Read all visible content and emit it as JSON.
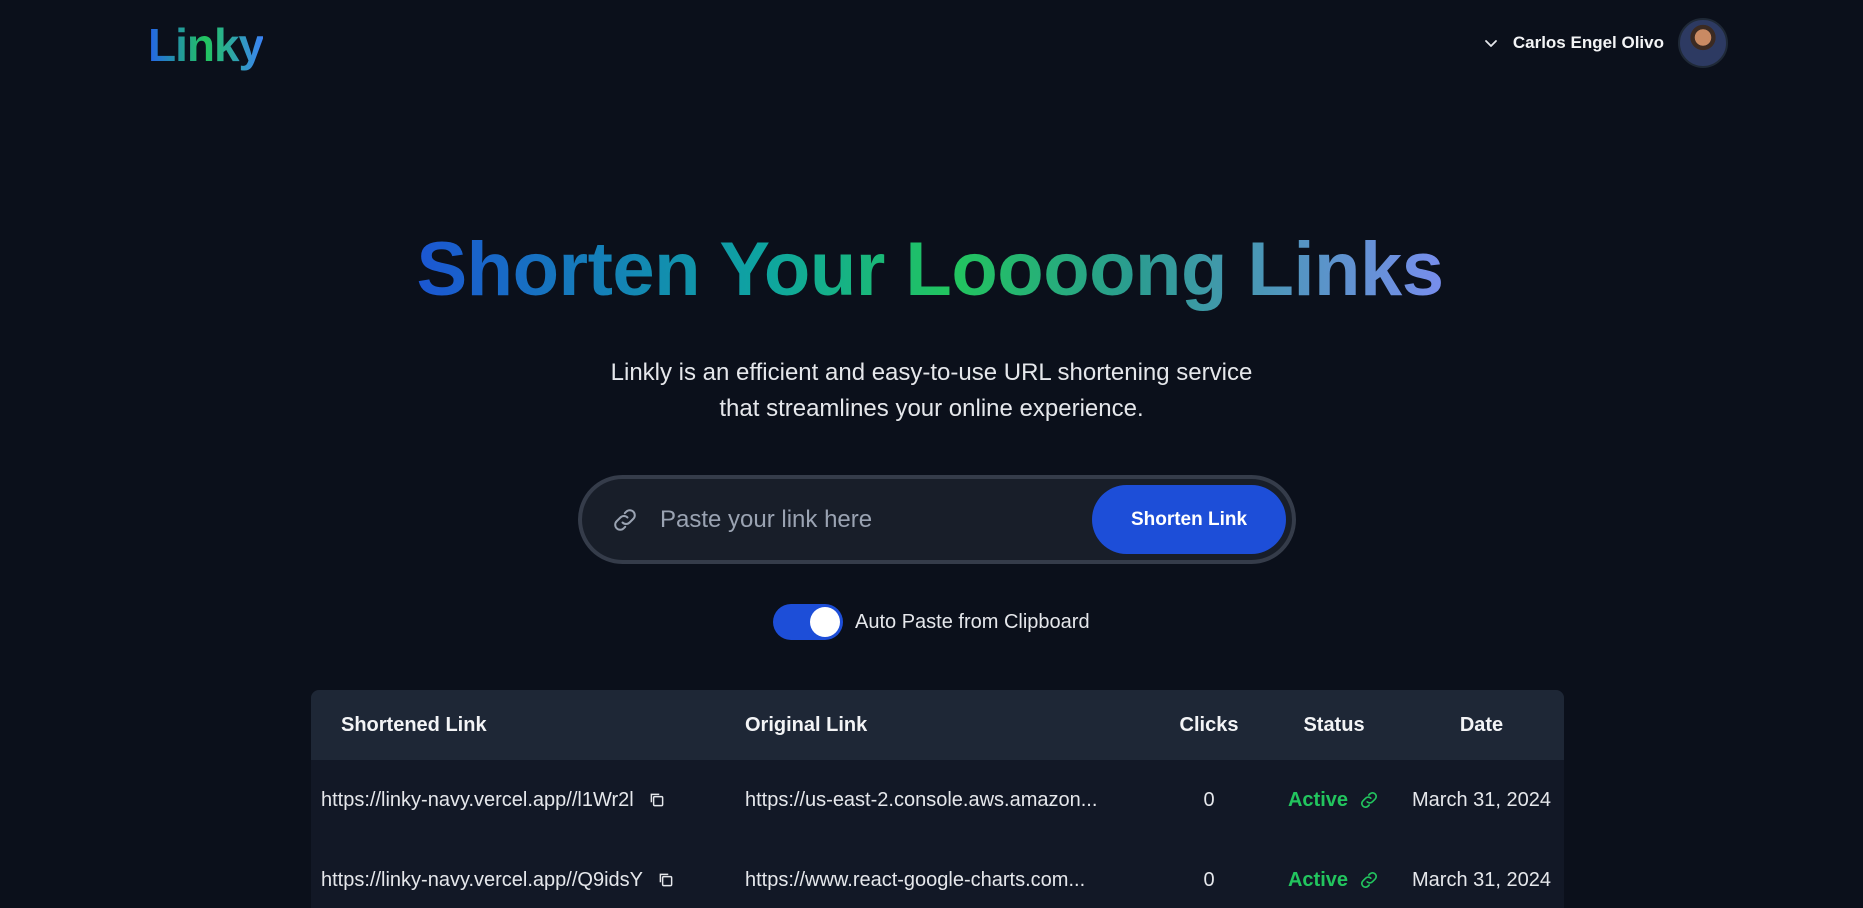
{
  "header": {
    "logo": "Linky",
    "user_name": "Carlos Engel Olivo",
    "chevron_icon": "chevron-down-icon",
    "avatar": "user-avatar"
  },
  "hero": {
    "title": "Shorten Your Loooong Links",
    "subtitle_line1": "Linkly is an efficient and easy-to-use URL shortening service",
    "subtitle_line2": "that streamlines your online experience."
  },
  "search": {
    "placeholder": "Paste your link here",
    "value": "",
    "button_label": "Shorten Link",
    "icon": "link-icon"
  },
  "toggle": {
    "label": "Auto Paste from Clipboard",
    "on": true
  },
  "table": {
    "headers": [
      "Shortened Link",
      "Original Link",
      "Clicks",
      "Status",
      "Date"
    ],
    "rows": [
      {
        "short": "https://linky-navy.vercel.app//l1Wr2l",
        "original": "https://us-east-2.console.aws.amazon...",
        "clicks": "0",
        "status": "Active",
        "date": "March 31, 2024"
      },
      {
        "short": "https://linky-navy.vercel.app//Q9idsY",
        "original": "https://www.react-google-charts.com...",
        "clicks": "0",
        "status": "Active",
        "date": "March 31, 2024"
      }
    ]
  },
  "colors": {
    "background": "#0b101b",
    "accent": "#1d4ed8",
    "active": "#22c55e"
  }
}
